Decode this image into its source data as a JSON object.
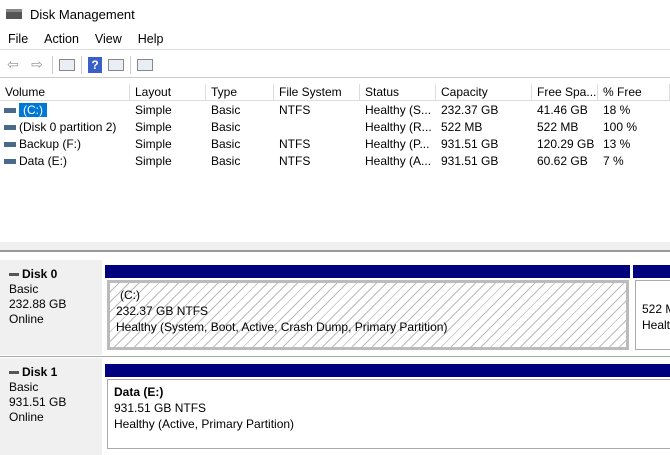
{
  "window": {
    "title": "Disk Management"
  },
  "menu": [
    "File",
    "Action",
    "View",
    "Help"
  ],
  "toolbar": {
    "icons": [
      "back-arrow-icon",
      "forward-arrow-icon",
      "console-tree-icon",
      "help-icon",
      "action-pane-icon",
      "properties-icon"
    ],
    "help_label": "?"
  },
  "table": {
    "columns": [
      "Volume",
      "Layout",
      "Type",
      "File System",
      "Status",
      "Capacity",
      "Free Spa...",
      "% Free"
    ],
    "rows": [
      [
        "(C:)",
        "Simple",
        "Basic",
        "NTFS",
        "Healthy (S...",
        "232.37 GB",
        "41.46 GB",
        "18 %"
      ],
      [
        "(Disk 0 partition 2)",
        "Simple",
        "Basic",
        "",
        "Healthy (R...",
        "522 MB",
        "522 MB",
        "100 %"
      ],
      [
        "Backup (F:)",
        "Simple",
        "Basic",
        "NTFS",
        "Healthy (P...",
        "931.51 GB",
        "120.29 GB",
        "13 %"
      ],
      [
        "Data (E:)",
        "Simple",
        "Basic",
        "NTFS",
        "Healthy (A...",
        "931.51 GB",
        "60.62 GB",
        "7 %"
      ]
    ]
  },
  "disks": [
    {
      "name": "Disk 0",
      "type": "Basic",
      "size": "232.88 GB",
      "state": "Online",
      "partitions": [
        {
          "label": "(C:)",
          "size": "232.37 GB NTFS",
          "status": "Healthy (System, Boot, Active, Crash Dump, Primary Partition)"
        },
        {
          "label": "",
          "size": "522 M",
          "status": "Health"
        }
      ]
    },
    {
      "name": "Disk 1",
      "type": "Basic",
      "size": "931.51 GB",
      "state": "Online",
      "partitions": [
        {
          "label": "Data  (E:)",
          "size": "931.51 GB NTFS",
          "status": "Healthy (Active, Primary Partition)"
        }
      ]
    }
  ],
  "colors": {
    "partition_bar": "#00007f",
    "selection": "#0078d7"
  }
}
